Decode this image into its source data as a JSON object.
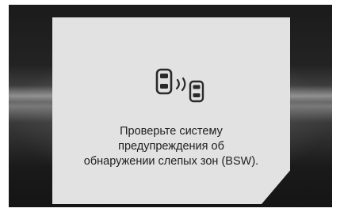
{
  "popup": {
    "icon": "blind-spot-warning-icon",
    "message_lines": [
      "Проверьте систему",
      "предупреждения об",
      "обнаружении слепых зон (BSW)."
    ]
  },
  "colors": {
    "popup_background": "#e2e2e2",
    "text": "#1e1e1e"
  }
}
